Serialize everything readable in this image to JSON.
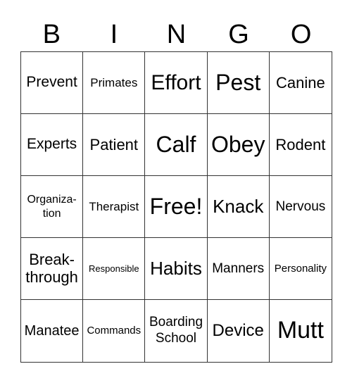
{
  "header": {
    "letters": [
      "B",
      "I",
      "N",
      "G",
      "O"
    ]
  },
  "card": {
    "cells": [
      "Prevent",
      "Primates",
      "Effort",
      "Pest",
      "Canine",
      "Experts",
      "Patient",
      "Calf",
      "Obey",
      "Rodent",
      "Organiza-\ntion",
      "Therapist",
      "Free!",
      "Knack",
      "Nervous",
      "Break-\nthrough",
      "Responsible",
      "Habits",
      "Manners",
      "Personality",
      "Manatee",
      "Commands",
      "Boarding\nSchool",
      "Device",
      "Mutt"
    ]
  }
}
